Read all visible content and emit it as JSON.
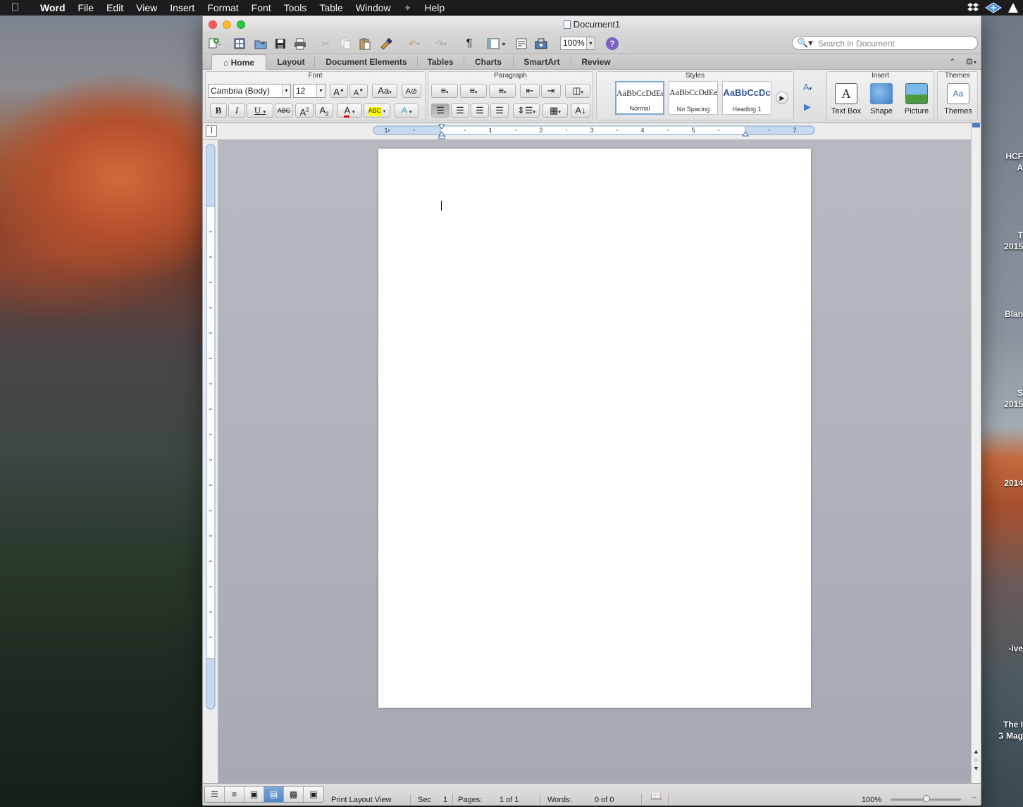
{
  "menubar": {
    "app": "Word",
    "items": [
      "File",
      "Edit",
      "View",
      "Insert",
      "Format",
      "Font",
      "Tools",
      "Table",
      "Window",
      "Help"
    ]
  },
  "window": {
    "title": "Document1"
  },
  "toolbar": {
    "zoom": "100%",
    "search_placeholder": "Search in Document"
  },
  "ribbon_tabs": [
    "Home",
    "Layout",
    "Document Elements",
    "Tables",
    "Charts",
    "SmartArt",
    "Review"
  ],
  "ribbon": {
    "font_group": "Font",
    "paragraph_group": "Paragraph",
    "styles_group": "Styles",
    "insert_group": "Insert",
    "themes_group": "Themes",
    "font_name": "Cambria (Body)",
    "font_size": "12",
    "styles": [
      {
        "sample": "AaBbCcDdEe",
        "name": "Normal"
      },
      {
        "sample": "AaBbCcDdEe",
        "name": "No Spacing"
      },
      {
        "sample": "AaBbCcDc",
        "name": "Heading 1"
      }
    ],
    "insert_items": [
      "Text Box",
      "Shape",
      "Picture"
    ],
    "themes_label": "Themes"
  },
  "ruler": {
    "labels": [
      "1",
      "1",
      "2",
      "3",
      "4",
      "5",
      "7"
    ]
  },
  "status": {
    "view": "Print Layout View",
    "sec_label": "Sec",
    "sec_value": "1",
    "pages_label": "Pages:",
    "pages_value": "1 of 1",
    "words_label": "Words:",
    "words_value": "0 of 0",
    "zoom": "100%"
  },
  "desktop": {
    "labels": [
      "HCF",
      "A",
      "T",
      "2015",
      "Blan",
      "S",
      "2015",
      "2014",
      "ive-",
      "The I",
      "G Mag"
    ]
  }
}
